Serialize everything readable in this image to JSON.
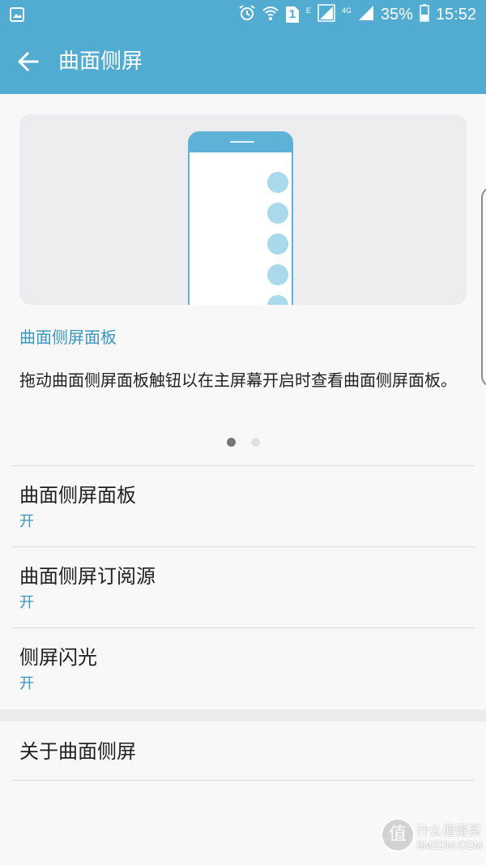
{
  "status_bar": {
    "network_type_e": "E",
    "network_type_4g": "4G",
    "battery_percent": "35%",
    "time": "15:52",
    "sim_slot": "1",
    "icons": [
      "gallery-icon",
      "alarm-icon",
      "wifi-icon",
      "sim-1-icon",
      "signal-icon",
      "signal-icon",
      "battery-icon"
    ]
  },
  "app_bar": {
    "title": "曲面侧屏",
    "back_icon": "arrow-back-icon",
    "color": "#52acd2"
  },
  "intro": {
    "caption": "曲面侧屏面板",
    "description": "拖动曲面侧屏面板触钮以在主屏幕开启时查看曲面侧屏面板。",
    "pager": {
      "pages": 2,
      "current": 1
    }
  },
  "settings": [
    {
      "title": "曲面侧屏面板",
      "status": "开"
    },
    {
      "title": "曲面侧屏订阅源",
      "status": "开"
    },
    {
      "title": "侧屏闪光",
      "status": "开"
    }
  ],
  "about": {
    "title": "关于曲面侧屏"
  },
  "watermark": {
    "glyph": "值",
    "cn": "什么值得买",
    "en": "SMZDM.COM"
  },
  "colors": {
    "accent": "#3a96bf",
    "appbar": "#52acd2",
    "background": "#f8f8f8"
  }
}
